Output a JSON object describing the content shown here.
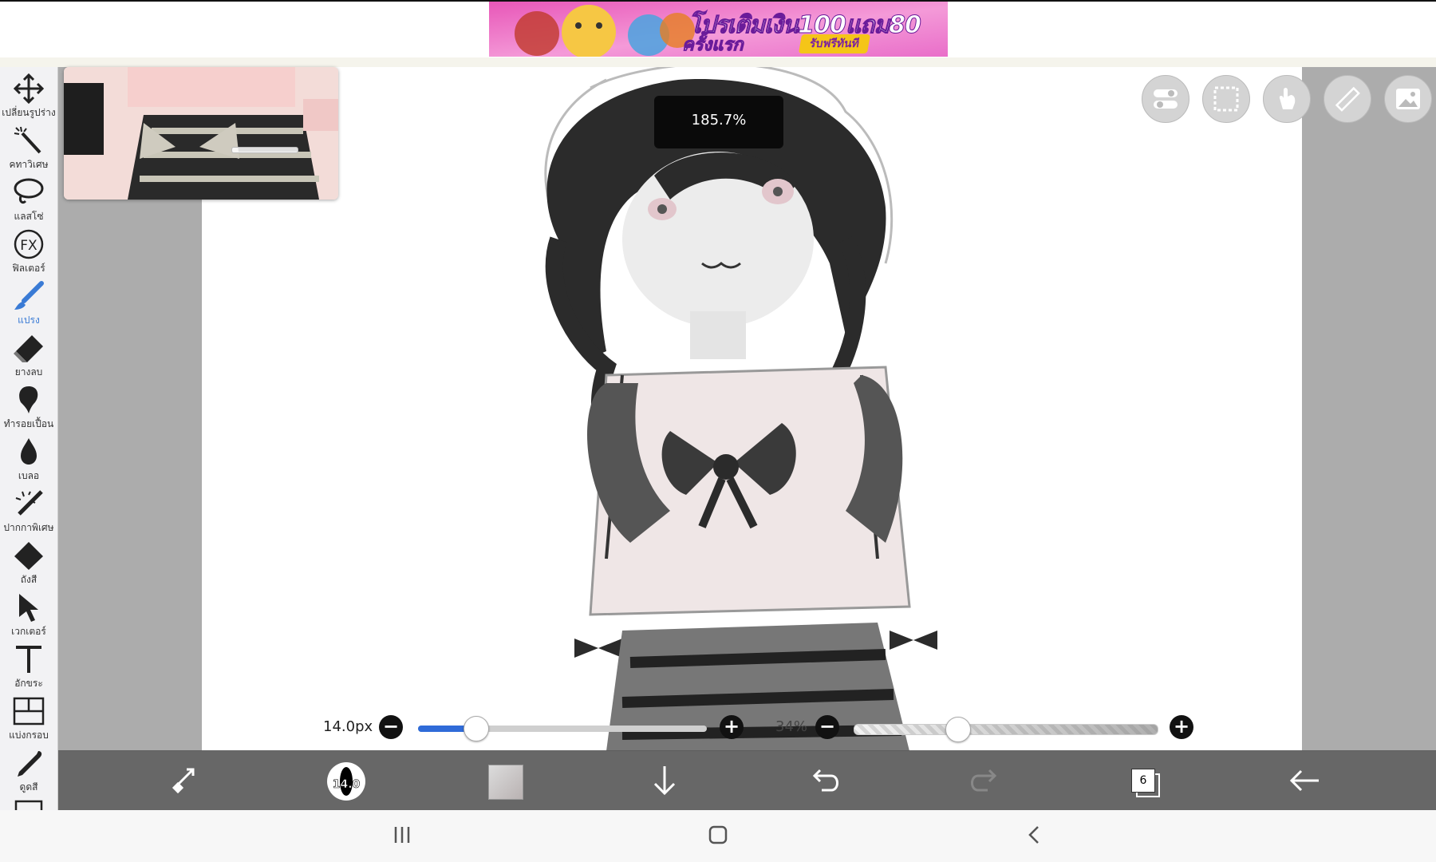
{
  "ad": {
    "line1": "โปรเติมเงิน100แถม80",
    "line2": "ครั้งแรก",
    "badge": "รับฟรีทันที"
  },
  "toolbar": {
    "items": [
      {
        "label": "เปลี่ยนรูปร่าง",
        "icon": "move-icon"
      },
      {
        "label": "คทาวิเศษ",
        "icon": "magic-wand-icon"
      },
      {
        "label": "แลสโซ่",
        "icon": "lasso-icon"
      },
      {
        "label": "ฟิลเตอร์",
        "icon": "fx-icon"
      },
      {
        "label": "แปรง",
        "icon": "brush-icon",
        "active": true
      },
      {
        "label": "ยางลบ",
        "icon": "eraser-icon"
      },
      {
        "label": "ทำรอยเปื้อน",
        "icon": "smudge-icon"
      },
      {
        "label": "เบลอ",
        "icon": "blur-drop-icon"
      },
      {
        "label": "ปากกาพิเศษ",
        "icon": "special-pen-icon"
      },
      {
        "label": "ถังสี",
        "icon": "bucket-icon"
      },
      {
        "label": "เวกเตอร์",
        "icon": "vector-cursor-icon"
      },
      {
        "label": "อักขระ",
        "icon": "text-icon"
      },
      {
        "label": "แบ่งกรอบ",
        "icon": "frame-divide-icon"
      },
      {
        "label": "ดูดสี",
        "icon": "eyedropper-icon"
      }
    ]
  },
  "canvas": {
    "zoom": "185.7%"
  },
  "quick_buttons": [
    "toggle-icon",
    "selection-icon",
    "hand-icon",
    "ruler-icon",
    "image-icon"
  ],
  "brush": {
    "size_label": "14.0px",
    "size_fraction": 0.2,
    "opacity_label": "34%",
    "opacity_fraction": 0.34,
    "badge_size": "14.0"
  },
  "bottom_bar": {
    "layer_count": "6"
  },
  "colors": {
    "accent": "#2f6bd8",
    "active_tool": "#3a7bd5",
    "workspace": "#acacac"
  }
}
